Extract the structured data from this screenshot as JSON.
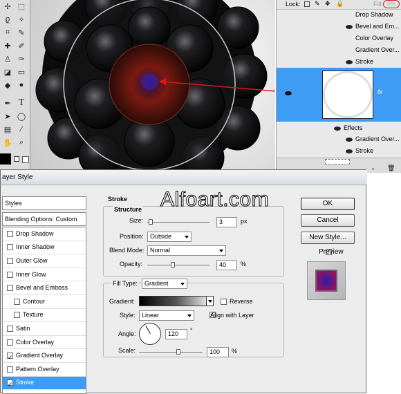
{
  "layers_panel": {
    "lock_label": "Lock:",
    "fill_label": "Fill:",
    "fill_value": "0%",
    "top_effects": [
      "Drop Shadow",
      "Bevel and Em...",
      "Color Overlay",
      "Gradient Over...",
      "Stroke"
    ],
    "fx_label": "fx",
    "effects_label": "Effects",
    "bottom_effects": [
      "Gradient Over...",
      "Stroke"
    ]
  },
  "watermark": "Alfoart.com",
  "dialog": {
    "title": "ayer Style",
    "styles_header": "Styles",
    "blending_options": "Blending Options: Custom",
    "items": [
      {
        "label": "Drop Shadow",
        "checked": false,
        "indent": false,
        "selected": false
      },
      {
        "label": "Inner Shadow",
        "checked": false,
        "indent": false,
        "selected": false
      },
      {
        "label": "Outer Glow",
        "checked": false,
        "indent": false,
        "selected": false
      },
      {
        "label": "Inner Glow",
        "checked": false,
        "indent": false,
        "selected": false
      },
      {
        "label": "Bevel and Emboss",
        "checked": false,
        "indent": false,
        "selected": false
      },
      {
        "label": "Contour",
        "checked": false,
        "indent": true,
        "selected": false
      },
      {
        "label": "Texture",
        "checked": false,
        "indent": true,
        "selected": false
      },
      {
        "label": "Satin",
        "checked": false,
        "indent": false,
        "selected": false
      },
      {
        "label": "Color Overlay",
        "checked": false,
        "indent": false,
        "selected": false
      },
      {
        "label": "Gradient Overlay",
        "checked": true,
        "indent": false,
        "selected": false
      },
      {
        "label": "Pattern Overlay",
        "checked": false,
        "indent": false,
        "selected": false
      },
      {
        "label": "Stroke",
        "checked": true,
        "indent": false,
        "selected": true
      }
    ],
    "stroke": {
      "section_title": "Stroke",
      "structure_title": "Structure",
      "size_label": "Size:",
      "size_value": "3",
      "size_unit": "px",
      "position_label": "Position:",
      "position_value": "Outside",
      "blend_mode_label": "Blend Mode:",
      "blend_mode_value": "Normal",
      "opacity_label": "Opacity:",
      "opacity_value": "40",
      "opacity_unit": "%",
      "fill_type_label": "Fill Type:",
      "fill_type_value": "Gradient",
      "gradient_label": "Gradient:",
      "reverse_label": "Reverse",
      "style_label": "Style:",
      "style_value": "Linear",
      "align_label": "Align with Layer",
      "angle_label": "Angle:",
      "angle_value": "120",
      "angle_unit": "°",
      "scale_label": "Scale:",
      "scale_value": "100",
      "scale_unit": "%"
    },
    "buttons": {
      "ok": "OK",
      "cancel": "Cancel",
      "new_style": "New Style...",
      "preview": "Preview"
    }
  },
  "colors": {
    "selection_blue": "#3f9cf5",
    "arrow_red": "#e0141c",
    "berry_dark": "#111111"
  }
}
